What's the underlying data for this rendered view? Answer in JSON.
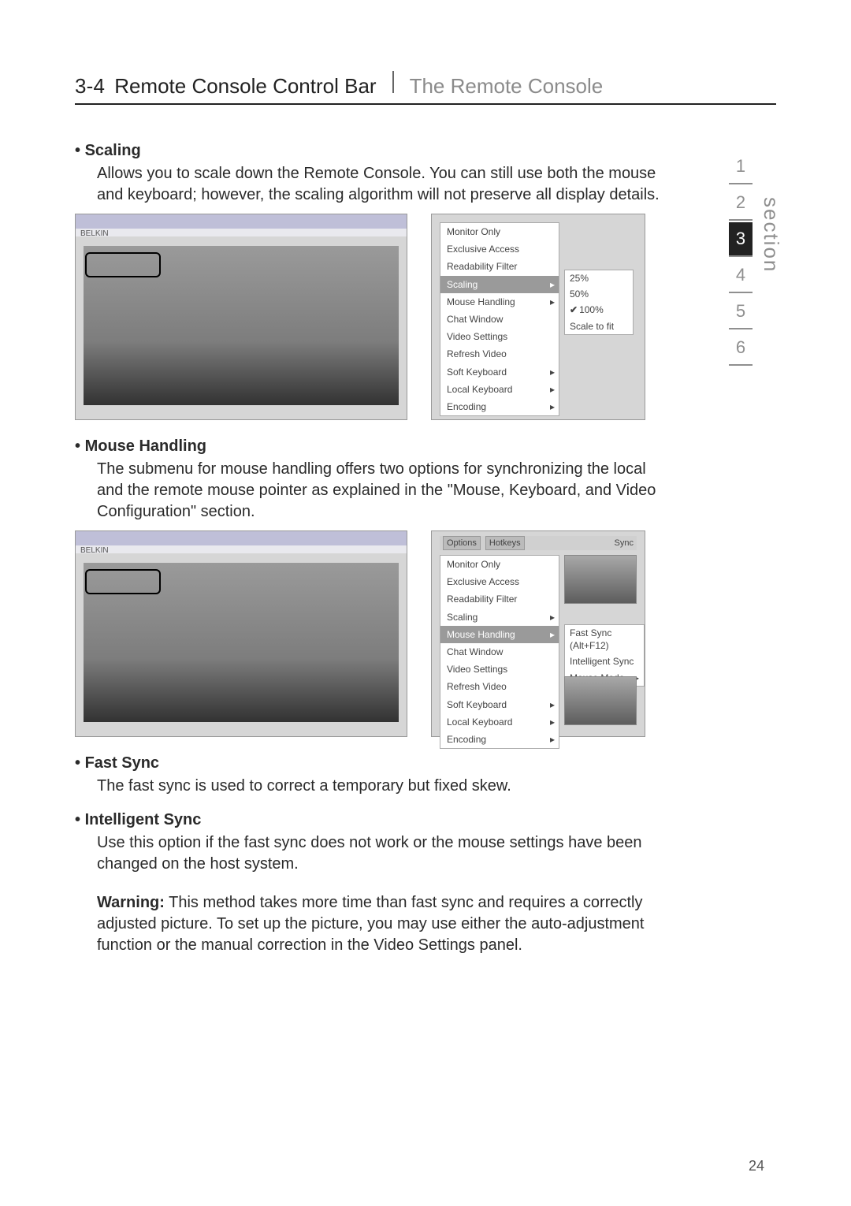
{
  "header": {
    "section_number": "3-4",
    "section_title": "Remote Console Control Bar",
    "chapter_title": "The Remote Console"
  },
  "sidebar": {
    "label": "section",
    "numbers": [
      "1",
      "2",
      "3",
      "4",
      "5",
      "6"
    ],
    "active_index": 2
  },
  "scaling": {
    "heading": "Scaling",
    "text": "Allows you to scale down the Remote Console. You can still use both the mouse and keyboard; however, the scaling algorithm will not preserve all display details."
  },
  "mouse_handling": {
    "heading": "Mouse Handling",
    "text": "The submenu for mouse handling offers two options for synchronizing the local and the remote mouse pointer as explained in the \"Mouse, Keyboard, and Video Configuration\" section."
  },
  "fast_sync": {
    "heading": "Fast Sync",
    "text": "The fast sync is used to correct a temporary but fixed skew."
  },
  "intel_sync": {
    "heading": "Intelligent Sync",
    "text": "Use this option if the fast sync does not work or the mouse settings have been changed on the host system."
  },
  "warning": {
    "label": "Warning:",
    "text": " This method takes more time than fast sync and requires a correctly adjusted picture. To set up the picture, you may use either the auto-adjustment function or the manual correction in the Video Settings panel."
  },
  "fig1": {
    "left_brand": "BELKIN",
    "context_menu": [
      {
        "label": "Monitor Only"
      },
      {
        "label": "Exclusive Access"
      },
      {
        "label": "Readability Filter"
      },
      {
        "label": "Scaling",
        "hi": true,
        "arrow": true
      },
      {
        "label": "Mouse Handling",
        "arrow": true
      },
      {
        "label": "Chat Window"
      },
      {
        "label": "Video Settings"
      },
      {
        "label": "Refresh Video"
      },
      {
        "label": "Soft Keyboard",
        "arrow": true
      },
      {
        "label": "Local Keyboard",
        "arrow": true
      },
      {
        "label": "Encoding",
        "arrow": true
      }
    ],
    "submenu": [
      {
        "label": "25%"
      },
      {
        "label": "50%"
      },
      {
        "label": "100%",
        "checked": true
      },
      {
        "label": "Scale to fit"
      }
    ]
  },
  "fig2": {
    "left_brand": "BELKIN",
    "toolbar": {
      "options": "Options",
      "hotkeys": "Hotkeys",
      "sync": "Sync"
    },
    "context_menu": [
      {
        "label": "Monitor Only"
      },
      {
        "label": "Exclusive Access"
      },
      {
        "label": "Readability Filter"
      },
      {
        "label": "Scaling",
        "arrow": true
      },
      {
        "label": "Mouse Handling",
        "hi": true,
        "arrow": true
      },
      {
        "label": "Chat Window"
      },
      {
        "label": "Video Settings"
      },
      {
        "label": "Refresh Video"
      },
      {
        "label": "Soft Keyboard",
        "arrow": true
      },
      {
        "label": "Local Keyboard",
        "arrow": true
      },
      {
        "label": "Encoding",
        "arrow": true
      }
    ],
    "submenu": [
      {
        "label": "Fast Sync (Alt+F12)"
      },
      {
        "label": "Intelligent Sync"
      },
      {
        "label": "Mouse Mode",
        "arrow": true
      }
    ]
  },
  "page_number": "24"
}
